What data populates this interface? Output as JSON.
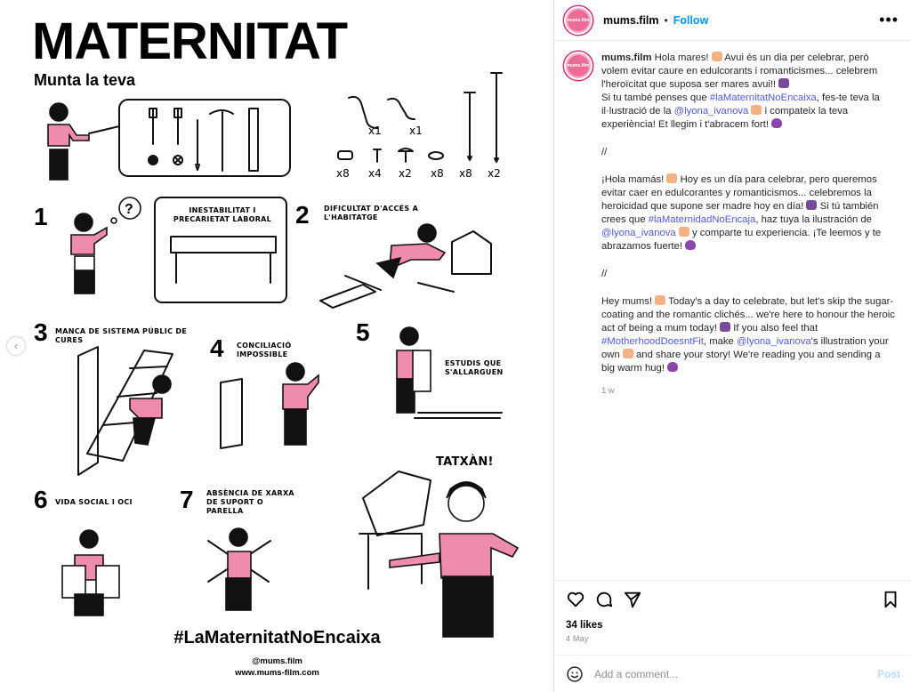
{
  "artwork": {
    "title": "MATERNITAT",
    "subtitle": "Munta la teva",
    "parts_quantities": [
      "x1",
      "x1",
      "x8",
      "x4",
      "x2",
      "x8",
      "x8",
      "x2"
    ],
    "steps": [
      {
        "number": "1",
        "caption": "INESTABILITAT I PRECARIETAT LABORAL"
      },
      {
        "number": "2",
        "caption": "DIFICULTAT D'ACCÉS A L'HABITATGE"
      },
      {
        "number": "3",
        "caption": "MANCA DE SISTEMA PÚBLIC DE CURES"
      },
      {
        "number": "4",
        "caption": "CONCILIACIÓ IMPOSSIBLE"
      },
      {
        "number": "5",
        "caption": "ESTUDIS QUE S'ALLARGUEN"
      },
      {
        "number": "6",
        "caption": "VIDA SOCIAL I OCI"
      },
      {
        "number": "7",
        "caption": "ABSÈNCIA DE XARXA DE SUPORT O PARELLA"
      }
    ],
    "exclamation": "TATXÀN!",
    "hashtag": "#LaMaternitatNoEncaixa",
    "credit_handle": "@mums.film",
    "credit_url": "www.mums-film.com"
  },
  "post": {
    "username": "mums.film",
    "avatar_text": "mums.film",
    "separator": "•",
    "follow_label": "Follow",
    "caption": {
      "ca_1": "Hola mares! ",
      "ca_2": " Avui és un dia per celebrar, però volem evitar caure en edulcorants i romanticismes... celebrem l'heroïcitat que suposa ser mares avui!! ",
      "ca_3": "Si tu també penses que ",
      "ca_tag": "#laMaternitatNoEncaixa",
      "ca_4": ", fes-te teva la il·lustració de la ",
      "ca_mention": "@lyona_ivanova",
      "ca_5": " i compateix la teva experiència! Et llegim i t'abracem fort! ",
      "sep1": "//",
      "es_1": "¡Hola mamás! ",
      "es_2": " Hoy es un día para celebrar, pero queremos evitar caer en edulcorantes y romanticismos... celebremos la heroicidad que supone ser madre hoy en día! ",
      "es_3": " Si tú también crees que ",
      "es_tag": "#laMaternidadNoEncaja",
      "es_4": ", haz tuya la ilustración de ",
      "es_mention": "@lyona_ivanova",
      "es_5": " y comparte tu experiencia. ¡Te leemos y te abrazamos fuerte! ",
      "sep2": "//",
      "en_1": "Hey mums! ",
      "en_2": " Today's a day to celebrate, but let's skip the sugar-coating and the romantic clichés... we're here to honour the heroic act of being a mum today! ",
      "en_3": " If you also feel that ",
      "en_tag": "#MotherhoodDoesntFit",
      "en_4": ", make ",
      "en_mention": "@lyona_ivanova",
      "en_5": "'s illustration your own ",
      "en_6": " and share your story! We're reading you and sending a big warm hug! ",
      "age": "1 w"
    },
    "likes": "34 likes",
    "date": "4 May",
    "comment_placeholder": "Add a comment...",
    "post_label": "Post"
  },
  "icons": [
    "more-icon",
    "heart-icon",
    "comment-icon",
    "share-icon",
    "bookmark-icon",
    "emoji-icon",
    "chevron-left-icon"
  ],
  "colors": {
    "accent": "#0095f6",
    "pink": "#f08bb0",
    "tag": "#4f5bd5",
    "muted": "#8e8e8e"
  }
}
